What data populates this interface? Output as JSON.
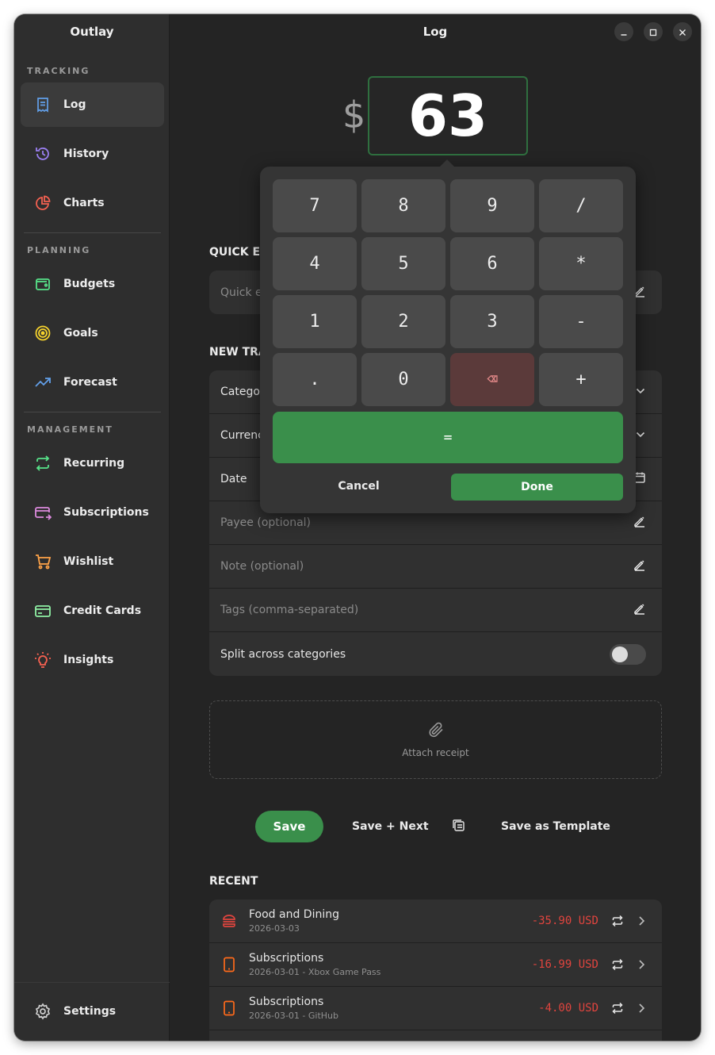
{
  "app": {
    "sidebar_title": "Outlay",
    "page_title": "Log"
  },
  "sidebar": {
    "sections": [
      {
        "label": "TRACKING",
        "items": [
          {
            "label": "Log",
            "icon": "receipt-icon",
            "color": "#62a0ea",
            "active": true
          },
          {
            "label": "History",
            "icon": "history-icon",
            "color": "#9a7ff0"
          },
          {
            "label": "Charts",
            "icon": "pie-chart-icon",
            "color": "#f66151"
          }
        ]
      },
      {
        "label": "PLANNING",
        "items": [
          {
            "label": "Budgets",
            "icon": "wallet-icon",
            "color": "#57e389"
          },
          {
            "label": "Goals",
            "icon": "target-icon",
            "color": "#f6d32d"
          },
          {
            "label": "Forecast",
            "icon": "trend-up-icon",
            "color": "#62a0ea"
          }
        ]
      },
      {
        "label": "MANAGEMENT",
        "items": [
          {
            "label": "Recurring",
            "icon": "repeat-icon",
            "color": "#57e389"
          },
          {
            "label": "Subscriptions",
            "icon": "card-transfer-icon",
            "color": "#dc8add"
          },
          {
            "label": "Wishlist",
            "icon": "cart-icon",
            "color": "#ffa348"
          },
          {
            "label": "Credit Cards",
            "icon": "credit-card-icon",
            "color": "#8ff0a4"
          },
          {
            "label": "Insights",
            "icon": "bulb-icon",
            "color": "#f66151"
          }
        ]
      }
    ],
    "settings_label": "Settings"
  },
  "amount": {
    "currency_symbol": "$",
    "value": "63"
  },
  "quick_entry": {
    "heading": "QUICK EN",
    "placeholder": "Quick e"
  },
  "new_transaction": {
    "heading": "NEW TRA",
    "category_label": "Categor",
    "currency_label": "Currenc",
    "date_label": "Date",
    "payee_placeholder": "Payee (optional)",
    "note_placeholder": "Note (optional)",
    "tags_placeholder": "Tags (comma-separated)",
    "split_label": "Split across categories"
  },
  "receipt": {
    "label": "Attach receipt"
  },
  "actions": {
    "save": "Save",
    "save_next": "Save + Next",
    "save_template": "Save as Template"
  },
  "recent": {
    "heading": "RECENT",
    "items": [
      {
        "title": "Food and Dining",
        "sub": "2026-03-03",
        "amount": "-35.90 USD",
        "icon": "burger-icon"
      },
      {
        "title": "Subscriptions",
        "sub": "2026-03-01 - Xbox Game Pass",
        "amount": "-16.99 USD",
        "icon": "phone-icon"
      },
      {
        "title": "Subscriptions",
        "sub": "2026-03-01 - GitHub",
        "amount": "-4.00 USD",
        "icon": "phone-icon"
      }
    ]
  },
  "keypad": {
    "keys": [
      "7",
      "8",
      "9",
      "/",
      "4",
      "5",
      "6",
      "*",
      "1",
      "2",
      "3",
      "-",
      ".",
      "0",
      "⌫",
      "+"
    ],
    "equals": "=",
    "cancel": "Cancel",
    "done": "Done"
  },
  "colors": {
    "accent": "#3a8f4b",
    "negative": "#e0443e",
    "delete_key": "#5b3a3a"
  }
}
